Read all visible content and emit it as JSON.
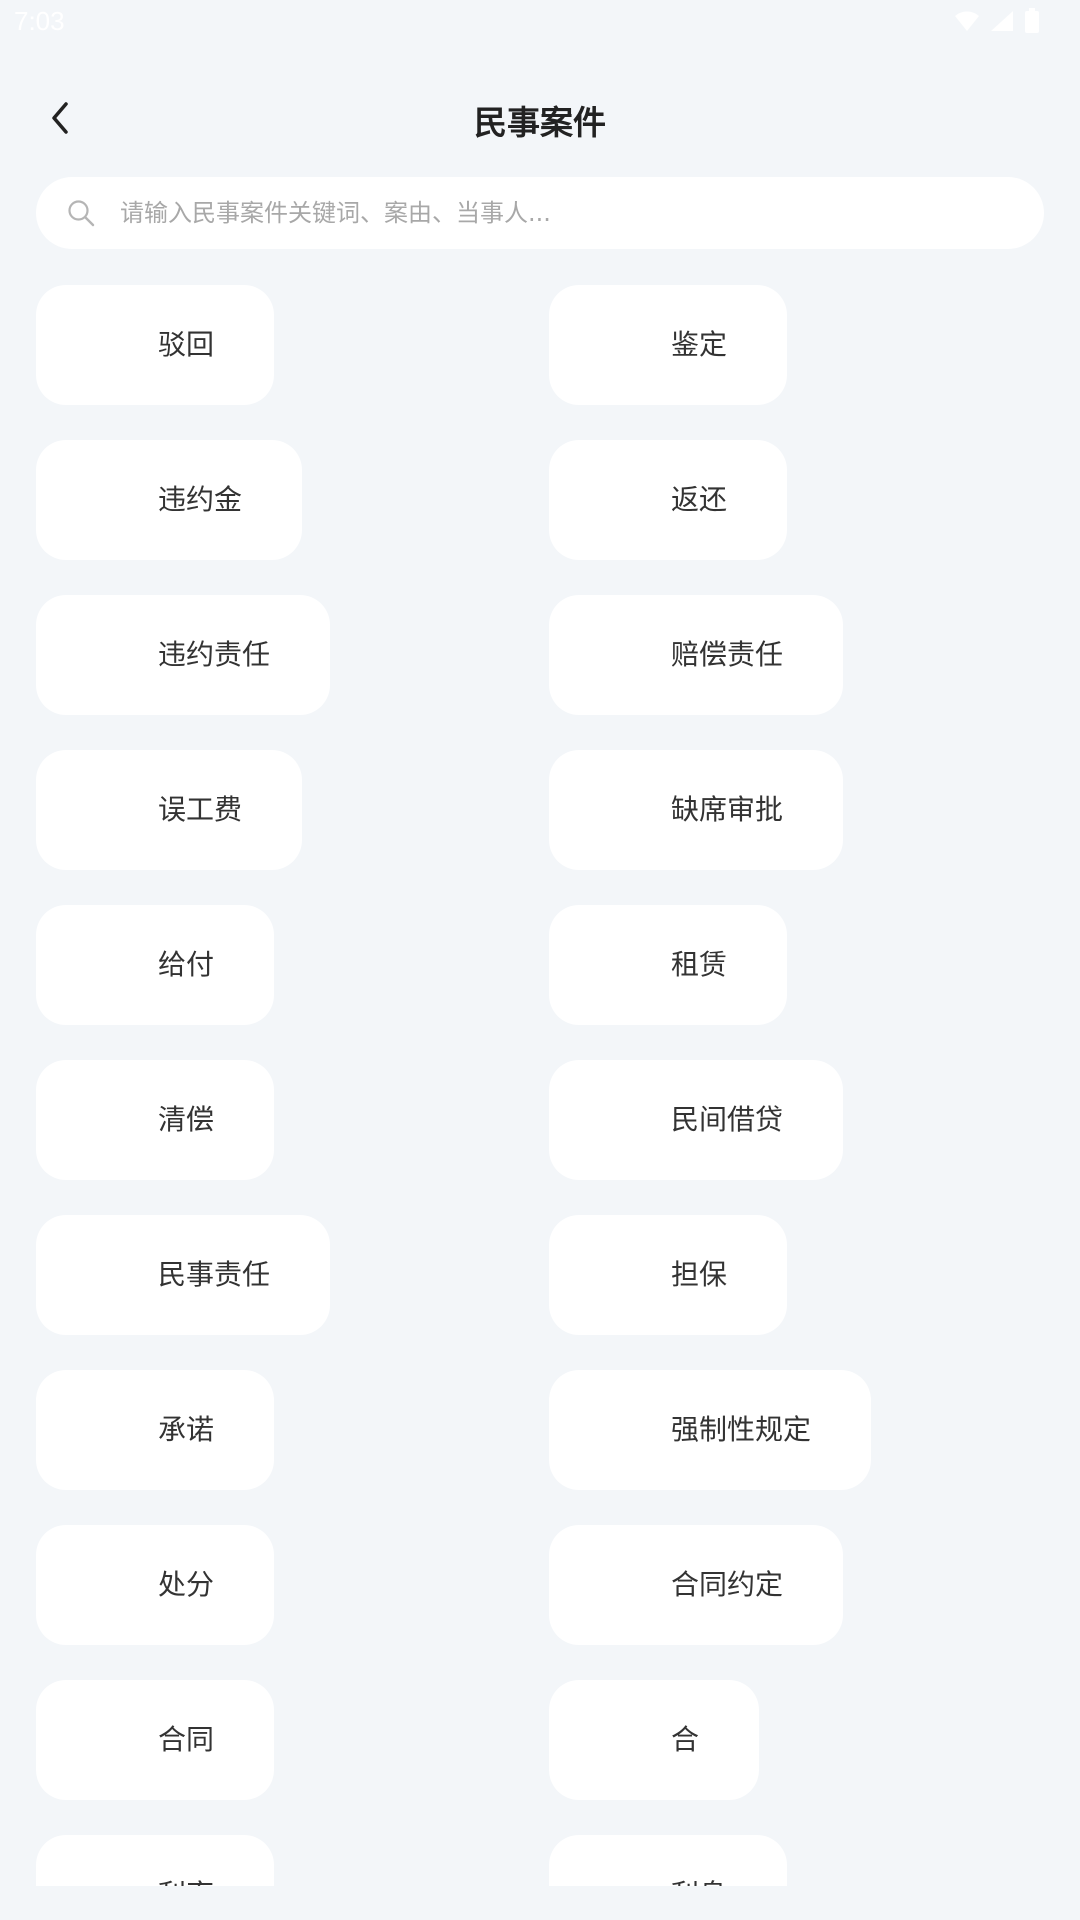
{
  "status_bar": {
    "time": "7:03"
  },
  "header": {
    "title": "民事案件",
    "back_icon": "chevron-left"
  },
  "search": {
    "placeholder": "请输入民事案件关键词、案由、当事人...",
    "icon": "search-icon"
  },
  "tags": [
    "驳回",
    "鉴定",
    "违约金",
    "返还",
    "违约责任",
    "赔偿责任",
    "误工费",
    "缺席审批",
    "给付",
    "租赁",
    "清偿",
    "民间借贷",
    "民事责任",
    "担保",
    "承诺",
    "强制性规定",
    "处分",
    "合同约定",
    "合同",
    "合",
    "利率",
    "利息"
  ],
  "colors": {
    "background": "#f3f6f9",
    "card": "#ffffff",
    "text": "#333333",
    "placeholder": "#a8a8a8"
  }
}
